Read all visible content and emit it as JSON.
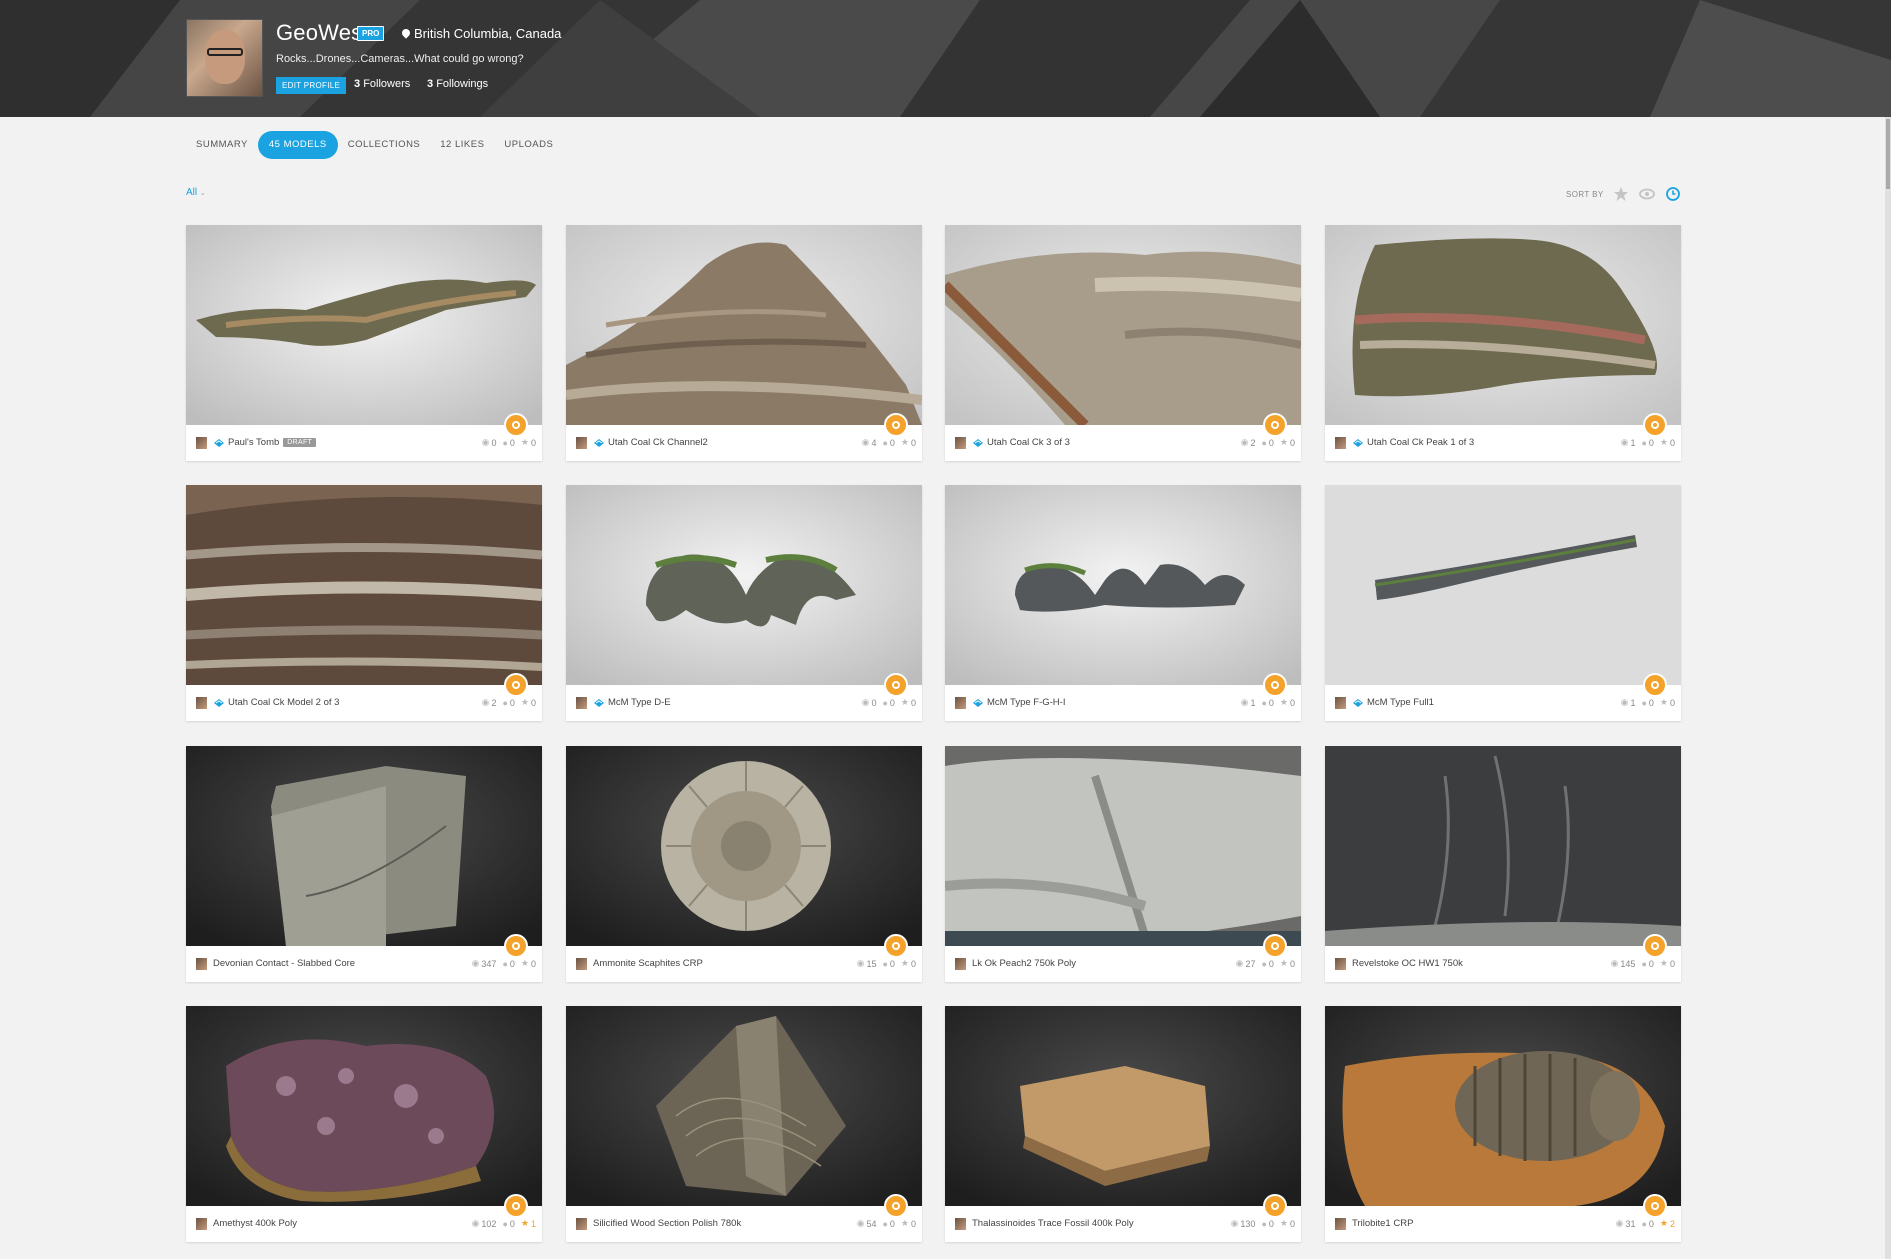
{
  "profile": {
    "username": "GeoWes",
    "badge": "PRO",
    "location": "British Columbia, Canada",
    "tagline": "Rocks...Drones...Cameras...What could go wrong?",
    "edit_label": "EDIT PROFILE",
    "followers_count": "3",
    "followers_label": "Followers",
    "followings_count": "3",
    "followings_label": "Followings"
  },
  "tabs": [
    {
      "label": "SUMMARY",
      "active": false
    },
    {
      "label": "45  MODELS",
      "active": true
    },
    {
      "label": "COLLECTIONS",
      "active": false
    },
    {
      "label": "12  LIKES",
      "active": false
    },
    {
      "label": "UPLOADS",
      "active": false
    }
  ],
  "filter": {
    "label": "All"
  },
  "sort": {
    "label": "SORT BY",
    "icons": [
      "star-icon",
      "eye-icon",
      "clock-icon"
    ]
  },
  "colors": {
    "accent": "#1aa3e0",
    "badge": "#f4a22a",
    "header": "#3a3a3a"
  },
  "models": [
    {
      "title": "Paul's Tomb",
      "staff_pick": true,
      "draft": "DRAFT",
      "views": "0",
      "comments": "0",
      "likes": "0",
      "liked": false
    },
    {
      "title": "Utah Coal Ck Channel2",
      "staff_pick": true,
      "views": "4",
      "comments": "0",
      "likes": "0",
      "liked": false
    },
    {
      "title": "Utah Coal Ck 3 of 3",
      "staff_pick": true,
      "views": "2",
      "comments": "0",
      "likes": "0",
      "liked": false
    },
    {
      "title": "Utah Coal Ck Peak 1 of 3",
      "staff_pick": true,
      "views": "1",
      "comments": "0",
      "likes": "0",
      "liked": false
    },
    {
      "title": "Utah Coal Ck Model 2 of 3",
      "staff_pick": true,
      "views": "2",
      "comments": "0",
      "likes": "0",
      "liked": false
    },
    {
      "title": "McM Type D-E",
      "staff_pick": true,
      "views": "0",
      "comments": "0",
      "likes": "0",
      "liked": false
    },
    {
      "title": "McM Type F-G-H-I",
      "staff_pick": true,
      "views": "1",
      "comments": "0",
      "likes": "0",
      "liked": false
    },
    {
      "title": "McM Type Full1",
      "staff_pick": true,
      "views": "1",
      "comments": "0",
      "likes": "0",
      "liked": false
    },
    {
      "title": "Devonian Contact - Slabbed Core",
      "staff_pick": false,
      "views": "347",
      "comments": "0",
      "likes": "0",
      "liked": false
    },
    {
      "title": "Ammonite Scaphites CRP",
      "staff_pick": false,
      "views": "15",
      "comments": "0",
      "likes": "0",
      "liked": false
    },
    {
      "title": "Lk Ok Peach2 750k Poly",
      "staff_pick": false,
      "views": "27",
      "comments": "0",
      "likes": "0",
      "liked": false
    },
    {
      "title": "Revelstoke OC HW1 750k",
      "staff_pick": false,
      "views": "145",
      "comments": "0",
      "likes": "0",
      "liked": false
    },
    {
      "title": "Amethyst 400k Poly",
      "staff_pick": false,
      "views": "102",
      "comments": "0",
      "likes": "1",
      "liked": true
    },
    {
      "title": "Silicified Wood Section Polish 780k",
      "staff_pick": false,
      "views": "54",
      "comments": "0",
      "likes": "0",
      "liked": false
    },
    {
      "title": "Thalassinoides Trace Fossil 400k Poly",
      "staff_pick": false,
      "views": "130",
      "comments": "0",
      "likes": "0",
      "liked": false
    },
    {
      "title": "Trilobite1 CRP",
      "staff_pick": false,
      "views": "31",
      "comments": "0",
      "likes": "2",
      "liked": true
    }
  ]
}
